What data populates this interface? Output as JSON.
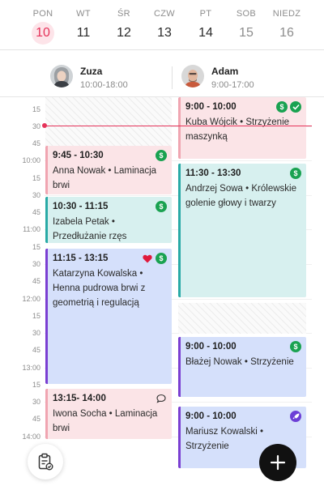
{
  "week": {
    "days": [
      {
        "name": "PON",
        "num": "10"
      },
      {
        "name": "WT",
        "num": "11"
      },
      {
        "name": "ŚR",
        "num": "12"
      },
      {
        "name": "CZW",
        "num": "13"
      },
      {
        "name": "PT",
        "num": "14"
      },
      {
        "name": "SOB",
        "num": "15"
      },
      {
        "name": "NIEDZ",
        "num": "16"
      }
    ],
    "selected_day": "10",
    "accent_color": "#e5335a"
  },
  "staff": [
    {
      "name": "Zuza",
      "hours": "10:00-18:00",
      "avatar_icon": "person-avatar-icon"
    },
    {
      "name": "Adam",
      "hours": "9:00-17:00",
      "avatar_icon": "person-avatar-icon"
    }
  ],
  "time_labels": [
    "15",
    "30",
    "45",
    "10:00",
    "15",
    "30",
    "45",
    "11:00",
    "15",
    "30",
    "45",
    "12:00",
    "15",
    "30",
    "45",
    "13:00",
    "15",
    "30",
    "45",
    "14:00"
  ],
  "appointments": {
    "zuza": [
      {
        "time": "9:45 - 10:30",
        "description": "Anna Nowak • Laminacja brwi",
        "icons": [
          "dollar-icon"
        ]
      },
      {
        "time": "10:30 - 11:15",
        "description": "Izabela Petak • Przedłużanie rzęs",
        "icons": [
          "dollar-icon"
        ]
      },
      {
        "time": "11:15 - 13:15",
        "description": "Katarzyna Kowalska • Henna pudrowa brwi z geometrią i regulacją",
        "icons": [
          "heart-icon",
          "dollar-icon"
        ]
      },
      {
        "time": "13:15- 14:00",
        "description": "Iwona Socha • Laminacja brwi",
        "icons": [
          "comment-icon"
        ]
      }
    ],
    "adam": [
      {
        "time": "9:00 - 10:00",
        "description": "Kuba Wójcik • Strzyżenie maszynką",
        "icons": [
          "dollar-icon",
          "check-icon"
        ]
      },
      {
        "time": "11:30 - 13:30",
        "description": "Andrzej Sowa • Królewskie golenie głowy i twarzy",
        "icons": [
          "dollar-icon"
        ]
      },
      {
        "time": "9:00 - 10:00",
        "description": "Błażej Nowak • Strzyżenie",
        "icons": [
          "dollar-icon"
        ]
      },
      {
        "time": "9:00 - 10:00",
        "description": "Mariusz Kowalski • Strzyżenie",
        "icons": [
          "rocket-icon"
        ]
      }
    ]
  },
  "colors": {
    "now_line": "#e5335a",
    "pink_block": "#fbe4e7",
    "teal_block": "#d7f0ef",
    "blue_block": "#d5e0fb",
    "paid_badge": "#1aa251"
  },
  "buttons": {
    "left_icon": "clipboard-check-icon",
    "add_icon": "plus-icon"
  }
}
